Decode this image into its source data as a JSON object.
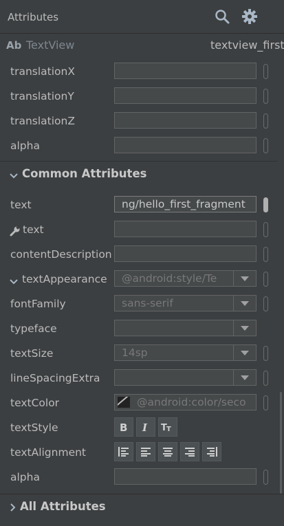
{
  "panel": {
    "title": "Attributes"
  },
  "component": {
    "type_badge": "Ab",
    "type": "TextView",
    "id": "textview_first"
  },
  "top_rows": [
    {
      "label": "translationX",
      "value": ""
    },
    {
      "label": "translationY",
      "value": ""
    },
    {
      "label": "translationZ",
      "value": ""
    },
    {
      "label": "alpha",
      "value": ""
    }
  ],
  "sections": {
    "common": "Common Attributes",
    "all": "All Attributes"
  },
  "common": {
    "text": {
      "label": "text",
      "value": "ng/hello_first_fragment"
    },
    "tools_text": {
      "label": "text",
      "value": ""
    },
    "content_description": {
      "label": "contentDescription",
      "value": ""
    },
    "text_appearance": {
      "label": "textAppearance",
      "value": "@android:style/Te"
    },
    "font_family": {
      "label": "fontFamily",
      "value": "sans-serif"
    },
    "typeface": {
      "label": "typeface",
      "value": ""
    },
    "text_size": {
      "label": "textSize",
      "value": "14sp"
    },
    "line_spacing_extra": {
      "label": "lineSpacingExtra",
      "value": ""
    },
    "text_color": {
      "label": "textColor",
      "value": "@android:color/seco"
    },
    "text_style": {
      "label": "textStyle"
    },
    "text_alignment": {
      "label": "textAlignment"
    },
    "alpha": {
      "label": "alpha",
      "value": ""
    }
  },
  "icons": {
    "search": "search-icon",
    "settings": "gear-icon",
    "minimize": "minimize-icon",
    "wrench": "wrench-icon",
    "expanded": "chevron-down-icon",
    "collapsed": "chevron-right-icon"
  },
  "colors": {
    "background": "#3c3f41",
    "field": "#45494a",
    "text": "#bbbbbb"
  }
}
